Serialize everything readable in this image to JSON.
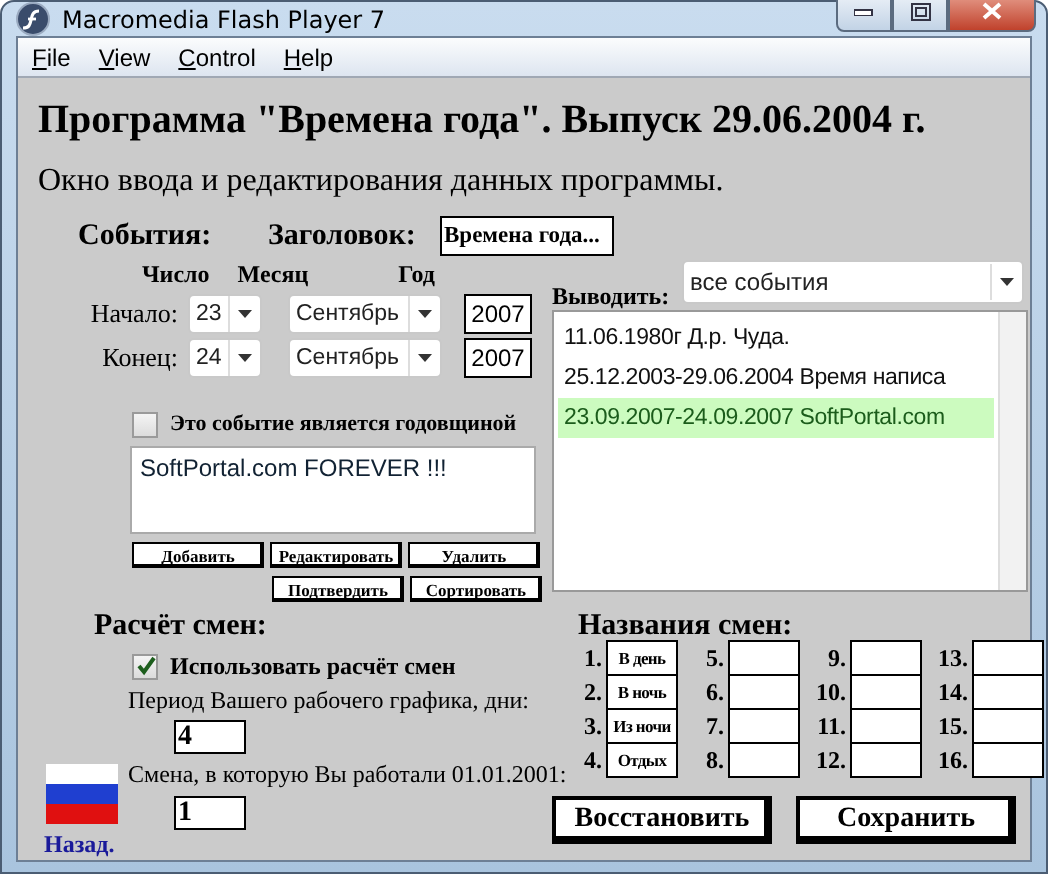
{
  "window": {
    "title": "Macromedia Flash Player 7"
  },
  "menu": [
    "File",
    "View",
    "Control",
    "Help"
  ],
  "heading": "Программа \"Времена года\". Выпуск 29.06.2004 г.",
  "subtitle": "Окно ввода и редактирования данных программы.",
  "events": {
    "label": "События:",
    "title_label": "Заголовок:",
    "title_value": "Времена года...",
    "columns": [
      "Число",
      "Месяц",
      "Год"
    ],
    "rows": [
      {
        "label": "Начало:",
        "day": "23",
        "month": "Сентябрь",
        "year": "2007"
      },
      {
        "label": "Конец:",
        "day": "24",
        "month": "Сентябрь",
        "year": "2007"
      }
    ],
    "anniversary": {
      "label": "Это событие является годовщиной",
      "checked": false
    },
    "note": "SoftPortal.com FOREVER !!!",
    "buttons": [
      [
        "Добавить",
        "Редактировать",
        "Удалить"
      ],
      [
        "Подтвердить",
        "Сортировать"
      ]
    ]
  },
  "filter": {
    "label": "Выводить:",
    "value": "все события"
  },
  "event_list": [
    {
      "text": "11.06.1980г Д.р. Чуда.",
      "selected": false
    },
    {
      "text": "25.12.2003-29.06.2004 Время написа",
      "selected": false
    },
    {
      "text": "23.09.2007-24.09.2007 SoftPortal.com",
      "selected": true
    }
  ],
  "shift_calc": {
    "label": "Расчёт смен:",
    "use": {
      "label": "Использовать расчёт смен",
      "checked": true
    },
    "period_label": "Период Вашего рабочего графика, дни:",
    "period": "4",
    "shift_label": "Смена, в которую Вы работали 01.01.2001:",
    "shift": "1"
  },
  "back_link": "Назад.",
  "shift_names": {
    "label": "Названия смен:",
    "items": [
      {
        "number": "1.",
        "value": "В день"
      },
      {
        "number": "2.",
        "value": "В ночь"
      },
      {
        "number": "3.",
        "value": "Из ночи"
      },
      {
        "number": "4.",
        "value": "Отдых"
      },
      {
        "number": "5."
      },
      {
        "number": "6."
      },
      {
        "number": "7."
      },
      {
        "number": "8."
      },
      {
        "number": "9."
      },
      {
        "number": "10."
      },
      {
        "number": "11."
      },
      {
        "number": "12."
      },
      {
        "number": "13."
      },
      {
        "number": "14."
      },
      {
        "number": "15."
      },
      {
        "number": "16."
      }
    ]
  },
  "actions": [
    "Восстановить",
    "Сохранить"
  ]
}
